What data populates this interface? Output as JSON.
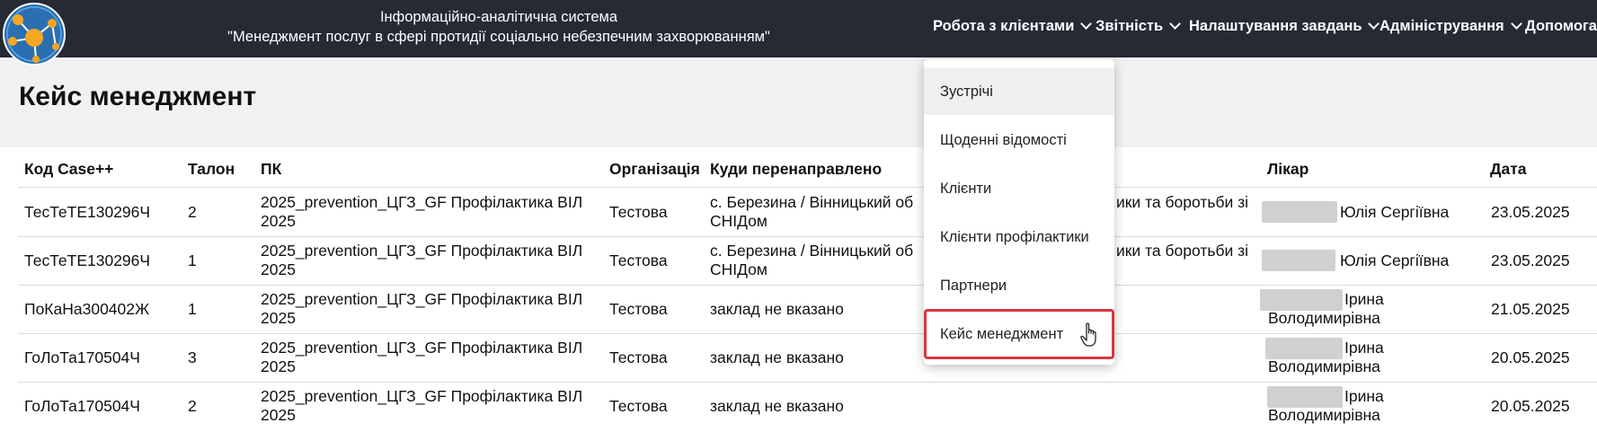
{
  "header": {
    "title_line1": "Інформаційно-аналітична система",
    "title_line2": "\"Менеджмент послуг в сфері протидії соціально небезпечним захворюванням\"",
    "logo_icon": "network-logo-icon"
  },
  "nav": {
    "clients": "Робота з клієнтами",
    "reports": "Звітність",
    "tasks": "Налаштування завдань",
    "admin": "Адміністрування",
    "help": "Допомога"
  },
  "page": {
    "title": "Кейс менеджмент"
  },
  "table": {
    "headers": [
      "Код Case++",
      "Талон",
      "ПК",
      "Організація",
      "Куди перенаправлено",
      "Лікар",
      "Дата"
    ],
    "rows": [
      {
        "code": "ТесТеТЕ130296Ч",
        "talon": "2",
        "pk1": "2025_prevention_ЦГЗ_GF Профілактика ВІЛ",
        "pk2": "2025",
        "org": "Тестова",
        "ref1": "с. Березина / Вінницький об",
        "ref1b": "ики та боротьби зі",
        "ref2": "СНІДом",
        "doc1": "Юлія Сергіївна",
        "doc2": "",
        "date": "23.05.2025"
      },
      {
        "code": "ТесТеТЕ130296Ч",
        "talon": "1",
        "pk1": "2025_prevention_ЦГЗ_GF Профілактика ВІЛ",
        "pk2": "2025",
        "org": "Тестова",
        "ref1": "с. Березина / Вінницький об",
        "ref1b": "ики та боротьби зі",
        "ref2": "СНІДом",
        "doc1": "Юлія Сергіївна",
        "doc2": "",
        "date": "23.05.2025"
      },
      {
        "code": "ПоКаНа300402Ж",
        "talon": "1",
        "pk1": "2025_prevention_ЦГЗ_GF Профілактика ВІЛ",
        "pk2": "2025",
        "org": "Тестова",
        "ref1": "заклад не вказано",
        "ref1b": "",
        "ref2": "",
        "doc1": "Ірина",
        "doc2": "Володимирівна",
        "date": "21.05.2025"
      },
      {
        "code": "ГоЛоТа170504Ч",
        "talon": "3",
        "pk1": "2025_prevention_ЦГЗ_GF Профілактика ВІЛ",
        "pk2": "2025",
        "org": "Тестова",
        "ref1": "заклад не вказано",
        "ref1b": "",
        "ref2": "",
        "doc1": "Ірина",
        "doc2": "Володимирівна",
        "date": "20.05.2025"
      },
      {
        "code": "ГоЛоТа170504Ч",
        "talon": "2",
        "pk1": "2025_prevention_ЦГЗ_GF Профілактика ВІЛ",
        "pk2": "2025",
        "org": "Тестова",
        "ref1": "заклад не вказано",
        "ref1b": "",
        "ref2": "",
        "doc1": "Ірина",
        "doc2": "Володимирівна",
        "date": "20.05.2025"
      }
    ]
  },
  "dropdown": {
    "items": [
      "Зустрічі",
      "Щоденні відомості",
      "Клієнти",
      "Клієнти профілактики",
      "Партнери",
      "Кейс менеджмент"
    ],
    "hovered": "Зустрічі",
    "selected": "Кейс менеджмент",
    "highlight_color": "#d9363e"
  },
  "colors": {
    "topbar": "#262a35",
    "page_bg": "#f1f1f2"
  }
}
